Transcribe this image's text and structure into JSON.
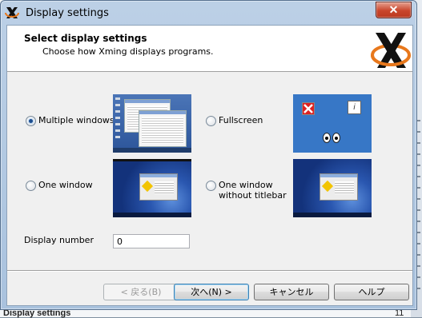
{
  "window": {
    "title": "Display settings",
    "close_label": "✕"
  },
  "header": {
    "title": "Select display settings",
    "subtitle": "Choose how Xming displays programs."
  },
  "options": [
    {
      "label": "Multiple windows",
      "checked": true
    },
    {
      "label": "Fullscreen",
      "checked": false
    },
    {
      "label": "One window",
      "checked": false
    },
    {
      "label": "One window\nwithout titlebar",
      "checked": false
    }
  ],
  "display_number": {
    "label": "Display number",
    "value": "0"
  },
  "buttons": {
    "back": "< 戻る(B)",
    "next": "次へ(N) >",
    "cancel": "キャンセル",
    "help": "ヘルプ"
  },
  "background": {
    "bottom_hint": "Display settings",
    "hint_number": "11"
  },
  "colors": {
    "accent": "#1d4e8f",
    "close": "#c9452b",
    "logo_orange": "#e8781c"
  }
}
